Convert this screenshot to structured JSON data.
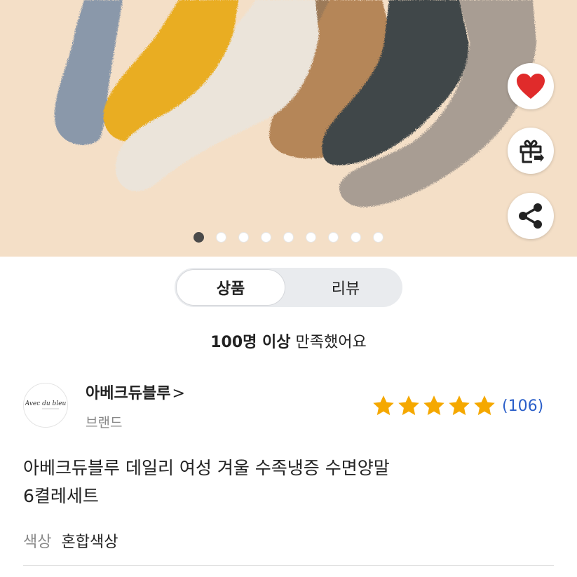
{
  "image": {
    "description_icon": "product-socks-image"
  },
  "actions": {
    "like_icon": "heart-icon",
    "gift_icon": "gift-icon",
    "share_icon": "share-icon",
    "like_color": "#e02b2b"
  },
  "carousel": {
    "total": 9,
    "current": 1
  },
  "tabs": [
    {
      "label": "상품",
      "active": true
    },
    {
      "label": "리뷰",
      "active": false
    }
  ],
  "satisfaction": {
    "highlight": "100명 이상",
    "rest": " 만족했어요"
  },
  "brand": {
    "name": "아베크듀블루",
    "chevron": ">",
    "type": "브랜드",
    "logo_text": "Avec du bleu"
  },
  "rating": {
    "stars": 5,
    "count": "(106)",
    "star_color": "#f5a800"
  },
  "product": {
    "title_line1": "아베크듀블루 데일리 여성 겨울 수족냉증 수면양말",
    "title_line2": "6켤레세트"
  },
  "option": {
    "label": "색상",
    "value": "혼합색상"
  }
}
